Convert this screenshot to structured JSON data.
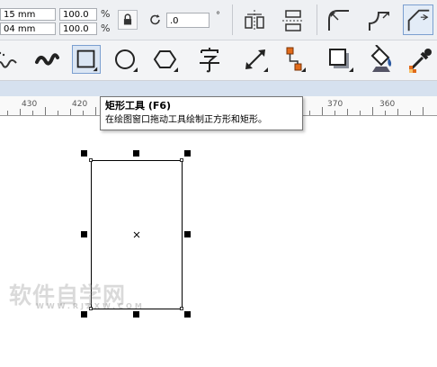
{
  "property_bar": {
    "width_value": "15 mm",
    "height_value": "04 mm",
    "scale_x": "100.0",
    "scale_y": "100.0",
    "percent_x": "%",
    "percent_y": "%",
    "rotation_value": ".0",
    "degree_symbol": "°"
  },
  "ruler": {
    "labels": [
      "430",
      "420",
      "370",
      "360"
    ]
  },
  "tooltip": {
    "title": "矩形工具 (F6)",
    "description": "在绘图窗口拖动工具绘制正方形和矩形。"
  },
  "watermark": {
    "text": "软件自学网",
    "sub": "WWW.RJZXW.COM"
  },
  "colors": {
    "accent": "#7b9fd0",
    "ruler_bg": "#f9f9f9",
    "toolbar_bg": "#f3f4f6"
  }
}
